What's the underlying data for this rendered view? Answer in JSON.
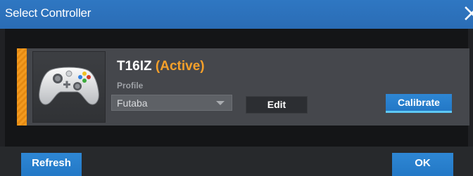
{
  "window": {
    "title": "Select Controller",
    "close_icon": "close-icon"
  },
  "controller": {
    "name": "T16IZ",
    "status": "(Active)",
    "image_icon": "gamepad-icon",
    "profile_label": "Profile",
    "profile_value": "Futaba",
    "edit_label": "Edit",
    "calibrate_label": "Calibrate"
  },
  "footer": {
    "refresh_label": "Refresh",
    "ok_label": "OK"
  },
  "colors": {
    "titlebar": "#2b70b8",
    "accent": "#f39a1f",
    "active_status": "#f5a02a",
    "button_blue": "#2a80cd",
    "button_underline": "#5ec8f4",
    "card_bg": "#45474c"
  }
}
